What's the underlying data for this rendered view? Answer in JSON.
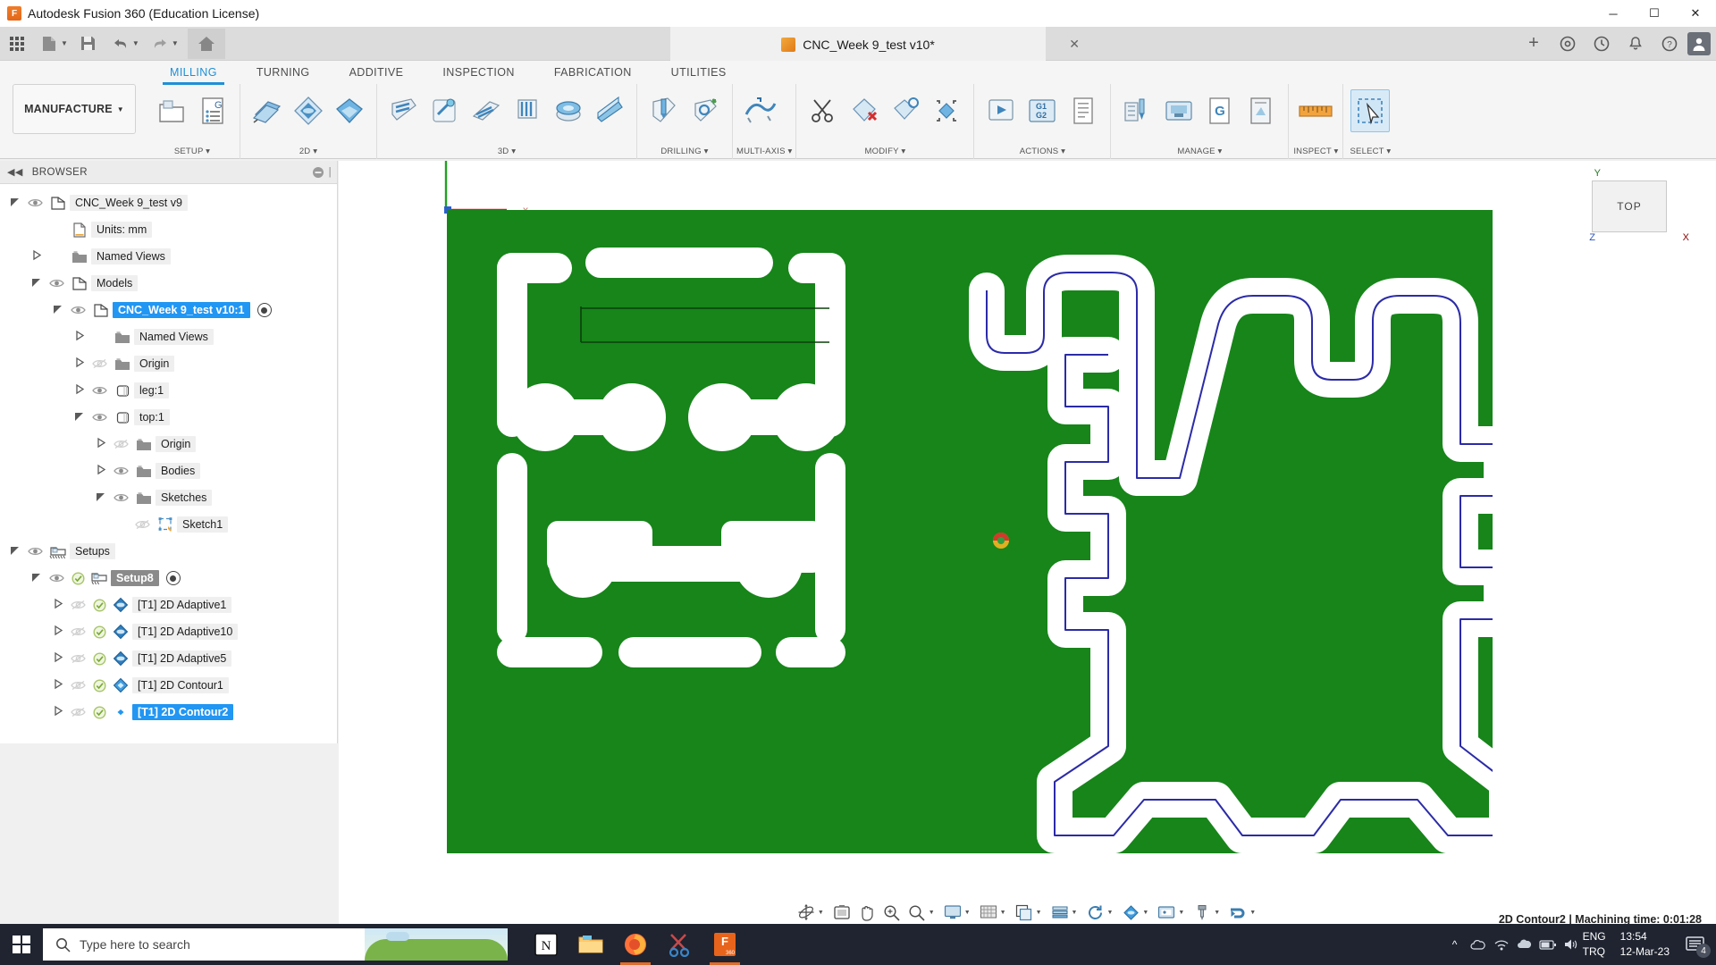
{
  "titlebar": {
    "app_title": "Autodesk Fusion 360 (Education License)",
    "app_icon": "fusion-logo-icon",
    "minimize": "─",
    "maximize": "☐",
    "close": "✕"
  },
  "quickaccess": {
    "grid_icon": "app-grid-icon",
    "new_icon": "new-document-icon",
    "save_icon": "save-icon",
    "undo_icon": "undo-icon",
    "redo_icon": "redo-icon",
    "home_icon": "home-icon",
    "document_tab": "CNC_Week 9_test v10*",
    "document_close": "✕",
    "add_tab": "+",
    "help_icon": "help-icon",
    "notification_icon": "bell-icon",
    "job_icon": "job-status-icon",
    "extension_icon": "extension-icon",
    "account_icon": "user-avatar-icon"
  },
  "ribbon": {
    "workspace": "MANUFACTURE",
    "tabs": [
      {
        "label": "MILLING",
        "active": true
      },
      {
        "label": "TURNING",
        "active": false
      },
      {
        "label": "ADDITIVE",
        "active": false
      },
      {
        "label": "INSPECTION",
        "active": false
      },
      {
        "label": "FABRICATION",
        "active": false
      },
      {
        "label": "UTILITIES",
        "active": false
      }
    ],
    "panels": [
      {
        "label": "SETUP ▾",
        "tools": [
          "setup-icon",
          "ncprogram-icon"
        ]
      },
      {
        "label": "2D ▾",
        "tools": [
          "face-icon",
          "adaptive2d-icon",
          "contour2d-icon"
        ]
      },
      {
        "label": "3D ▾",
        "tools": [
          "adaptive3d-icon",
          "pocket-clearing-icon",
          "parallel-icon",
          "contour3d-icon",
          "scallop-icon",
          "ramp-icon"
        ]
      },
      {
        "label": "DRILLING ▾",
        "tools": [
          "drill-icon",
          "bore-thread-icon"
        ]
      },
      {
        "label": "MULTI-AXIS ▾",
        "tools": [
          "swarf-icon"
        ]
      },
      {
        "label": "MODIFY ▾",
        "tools": [
          "cut-icon",
          "delete-toolpath-icon",
          "edit-toolpath-icon",
          "toolpath-modify-icon"
        ]
      },
      {
        "label": "ACTIONS ▾",
        "tools": [
          "simulate-icon",
          "post-process-icon",
          "setup-sheet-icon"
        ]
      },
      {
        "label": "MANAGE ▾",
        "tools": [
          "tool-library-icon",
          "machine-library-icon",
          "generate-icon",
          "template-icon"
        ]
      },
      {
        "label": "INSPECT ▾",
        "tools": [
          "measure-icon"
        ]
      },
      {
        "label": "SELECT ▾",
        "tools": [
          "select-icon"
        ]
      }
    ]
  },
  "browser": {
    "title": "BROWSER",
    "collapse_icon": "collapse-left-icon",
    "minimize_icon": "panel-minimize-icon",
    "tree": [
      {
        "indent": 0,
        "arrow": "open",
        "eye": "visible",
        "icon": "document-icon",
        "label": "CNC_Week 9_test v9",
        "state": "normal"
      },
      {
        "indent": 1,
        "arrow": "none",
        "eye": "none",
        "icon": "units-icon",
        "label": "Units: mm",
        "state": "normal"
      },
      {
        "indent": 1,
        "arrow": "closed",
        "eye": "none",
        "icon": "folder-icon",
        "label": "Named Views",
        "state": "normal"
      },
      {
        "indent": 1,
        "arrow": "open",
        "eye": "visible",
        "icon": "component-icon",
        "label": "Models",
        "state": "normal"
      },
      {
        "indent": 2,
        "arrow": "open",
        "eye": "visible",
        "icon": "component-icon",
        "label": "CNC_Week 9_test v10:1",
        "state": "selected-blue",
        "radio": true
      },
      {
        "indent": 3,
        "arrow": "closed",
        "eye": "none",
        "icon": "folder-icon",
        "label": "Named Views",
        "state": "normal"
      },
      {
        "indent": 3,
        "arrow": "closed",
        "eye": "hidden",
        "icon": "folder-icon",
        "label": "Origin",
        "state": "normal"
      },
      {
        "indent": 3,
        "arrow": "closed",
        "eye": "visible",
        "icon": "body-icon",
        "label": "leg:1",
        "state": "normal"
      },
      {
        "indent": 3,
        "arrow": "open",
        "eye": "visible",
        "icon": "body-icon",
        "label": "top:1",
        "state": "normal"
      },
      {
        "indent": 4,
        "arrow": "closed",
        "eye": "hidden",
        "icon": "folder-icon",
        "label": "Origin",
        "state": "normal"
      },
      {
        "indent": 4,
        "arrow": "closed",
        "eye": "visible",
        "icon": "folder-icon",
        "label": "Bodies",
        "state": "normal"
      },
      {
        "indent": 4,
        "arrow": "open",
        "eye": "visible",
        "icon": "folder-icon",
        "label": "Sketches",
        "state": "normal"
      },
      {
        "indent": 5,
        "arrow": "none",
        "eye": "hidden",
        "icon": "sketch-icon",
        "label": "Sketch1",
        "state": "normal"
      },
      {
        "indent": 0,
        "arrow": "open",
        "eye": "visible",
        "icon": "setups-icon",
        "label": "Setups",
        "state": "normal"
      },
      {
        "indent": 1,
        "arrow": "open",
        "eye": "visible",
        "check": true,
        "icon": "setup-icon",
        "label": "Setup8",
        "state": "selected-gray",
        "radio": true
      },
      {
        "indent": 2,
        "arrow": "closed",
        "eye": "hidden",
        "check": true,
        "icon": "adaptive-op-icon",
        "label": "[T1] 2D Adaptive1",
        "state": "normal"
      },
      {
        "indent": 2,
        "arrow": "closed",
        "eye": "hidden",
        "check": true,
        "icon": "adaptive-op-icon",
        "label": "[T1] 2D Adaptive10",
        "state": "normal"
      },
      {
        "indent": 2,
        "arrow": "closed",
        "eye": "hidden",
        "check": true,
        "icon": "adaptive-op-icon",
        "label": "[T1] 2D Adaptive5",
        "state": "normal"
      },
      {
        "indent": 2,
        "arrow": "closed",
        "eye": "hidden",
        "check": true,
        "icon": "contour-op-icon",
        "label": "[T1] 2D Contour1",
        "state": "normal"
      },
      {
        "indent": 2,
        "arrow": "closed",
        "eye": "hidden",
        "check": true,
        "icon": "contour-op-icon",
        "label": "[T1] 2D Contour2",
        "state": "selected-blue"
      }
    ]
  },
  "canvas": {
    "stock_color": "#17851a",
    "toolpath_color": "#2b2ba8",
    "pocket_color": "#ffffff",
    "viewcube_label": "TOP",
    "viewcube_y_axis": "Y",
    "viewcube_x_axis": "X",
    "viewcube_z_axis": "Z",
    "origin_x_label": "x"
  },
  "navbar": {
    "items": [
      {
        "icon": "orbit-icon",
        "caret": true
      },
      {
        "icon": "look-at-icon",
        "caret": false
      },
      {
        "icon": "pan-icon",
        "caret": false
      },
      {
        "icon": "zoom-icon",
        "caret": false
      },
      {
        "icon": "fit-icon",
        "caret": true
      },
      {
        "icon": "display-settings-icon",
        "caret": true
      },
      {
        "icon": "grid-snap-icon",
        "caret": true
      },
      {
        "icon": "viewports-icon",
        "caret": true
      },
      {
        "icon": "stock-visibility-icon",
        "caret": true
      },
      {
        "icon": "simulate-refresh-icon",
        "caret": true
      },
      {
        "icon": "toolpath-visibility-icon",
        "caret": true
      },
      {
        "icon": "machine-view-icon",
        "caret": true
      },
      {
        "icon": "tool-view-icon",
        "caret": true
      },
      {
        "icon": "probe-icon",
        "caret": true
      }
    ]
  },
  "statusbar": {
    "text": "2D Contour2 | Machining time: 0:01:28"
  },
  "taskbar": {
    "start_icon": "windows-start-icon",
    "search_placeholder": "Type here to search",
    "search_icon": "search-icon",
    "apps": [
      {
        "name": "notion-app-icon",
        "label": "N",
        "active": false
      },
      {
        "name": "file-explorer-icon",
        "label": "",
        "active": false
      },
      {
        "name": "firefox-icon",
        "label": "",
        "active": true
      },
      {
        "name": "snipping-tool-icon",
        "label": "",
        "active": false
      },
      {
        "name": "fusion360-icon",
        "label": "F",
        "active": true
      }
    ],
    "tray": {
      "chevron_icon": "show-hidden-icons-icon",
      "onedrive_icon": "onedrive-icon",
      "network_icon": "network-icon",
      "cloud_icon": "cloud-icon",
      "battery_icon": "battery-icon",
      "volume_icon": "volume-icon",
      "lang_line1": "ENG",
      "lang_line2": "TRQ",
      "time": "13:54",
      "date": "12-Mar-23",
      "notification_icon": "action-center-icon",
      "notification_count": "4"
    }
  }
}
